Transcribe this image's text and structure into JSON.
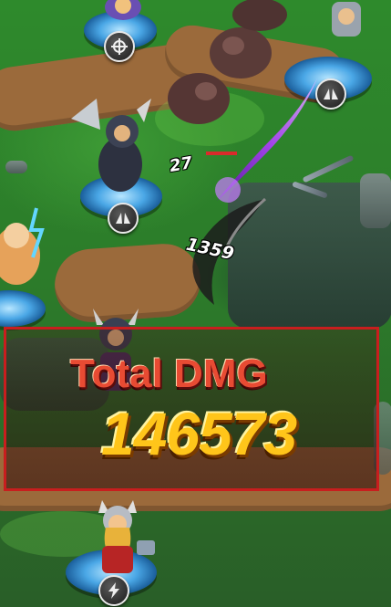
{
  "damage_panel": {
    "label": "Total DMG",
    "value": "146573",
    "border_color": "#c81e1e"
  },
  "damage_popups": [
    "27",
    "1359"
  ],
  "skill_icons": [
    "crosshair-icon",
    "wings-icon",
    "wings-icon",
    "lightning-icon"
  ],
  "heroes": [
    "armored-warrior",
    "lightning-mage",
    "horned-knight",
    "thor-hero",
    "winged-helm-hero"
  ],
  "enemies": [
    "rock-golem",
    "rock-golem",
    "rock-golem"
  ],
  "colors": {
    "grass": "#2e8a2c",
    "path": "#9b6a3b",
    "title_red": "#e84b33",
    "value_gold": "#ffc51a",
    "magic_purple": "#b13cff"
  }
}
